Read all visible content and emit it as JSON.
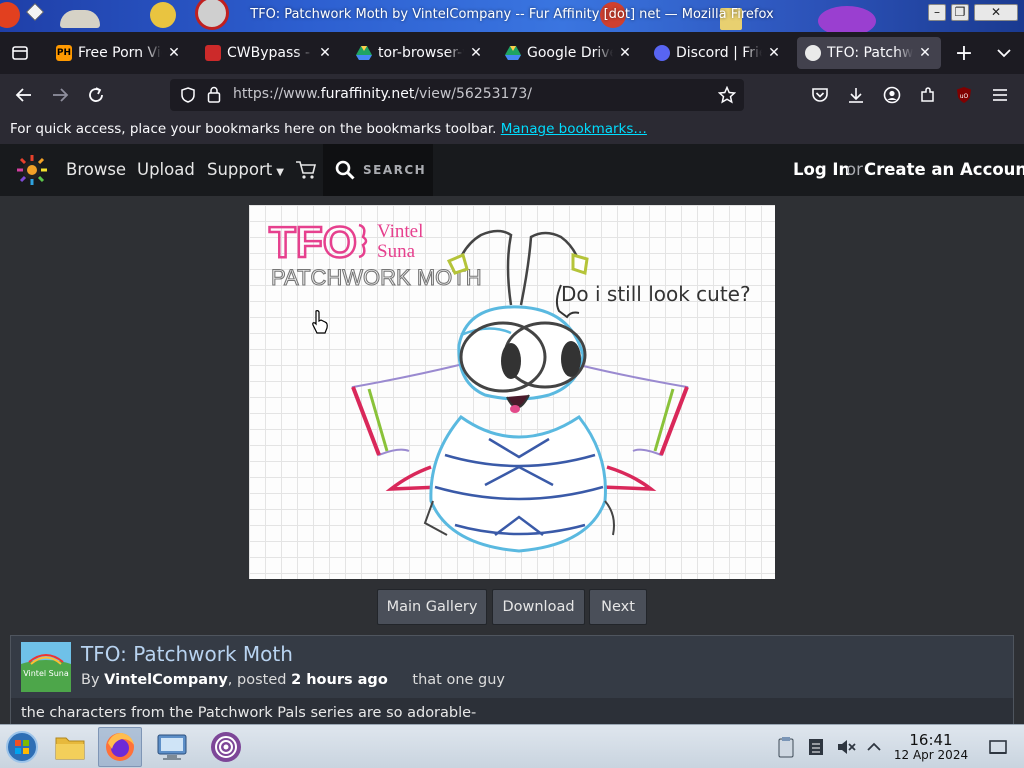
{
  "window": {
    "title": "TFO: Patchwork Moth by VintelCompany -- Fur Affinity [dot] net — Mozilla Firefox"
  },
  "tabs": [
    {
      "label": "Free Porn Videos",
      "icon": "pornhub-icon",
      "active": false
    },
    {
      "label": "CWBypass - Tor",
      "icon": "cwbypass-icon",
      "active": false
    },
    {
      "label": "tor-browser-windows",
      "icon": "google-drive-icon",
      "active": false
    },
    {
      "label": "Google Drive",
      "icon": "google-drive-icon",
      "active": false
    },
    {
      "label": "Discord | Friends",
      "icon": "discord-icon",
      "active": false
    },
    {
      "label": "TFO: Patchwork Moth",
      "icon": "furaffinity-icon",
      "active": true
    }
  ],
  "navbar": {
    "url_prefix": "https://www.",
    "url_domain": "furaffinity.net",
    "url_path": "/view/56253173/"
  },
  "bookmarks": {
    "hint": "For quick access, place your bookmarks here on the bookmarks toolbar.",
    "manage_link": "Manage bookmarks…"
  },
  "site_nav": {
    "browse": "Browse",
    "upload": "Upload",
    "support": "Support",
    "search_placeholder": "SEARCH",
    "login": "Log In",
    "or": "or",
    "create_account": "Create an Account"
  },
  "artwork": {
    "title_line1": "TFO",
    "side_line1": "Vintel",
    "side_line2": "Suna",
    "subtitle": "PATCHWORK MOTH",
    "speech": "Do i still look cute?"
  },
  "gallery_buttons": {
    "main_gallery": "Main Gallery",
    "download": "Download",
    "next": "Next"
  },
  "submission": {
    "title": "TFO: Patchwork Moth",
    "by": "By",
    "author": "VintelCompany",
    "posted": ", posted",
    "time_ago": "2 hours ago",
    "rating_tag": "that one guy",
    "description": "the characters from the Patchwork Pals series are so adorable-",
    "thumb_text": "Vintel Suna"
  },
  "taskbar": {
    "time": "16:41",
    "date": "12 Apr 2024"
  },
  "colors": {
    "accent_link": "#00ddff",
    "submission_title": "#b8d3f0",
    "site_header": "#181a1d",
    "page_bg": "#2e3034"
  }
}
